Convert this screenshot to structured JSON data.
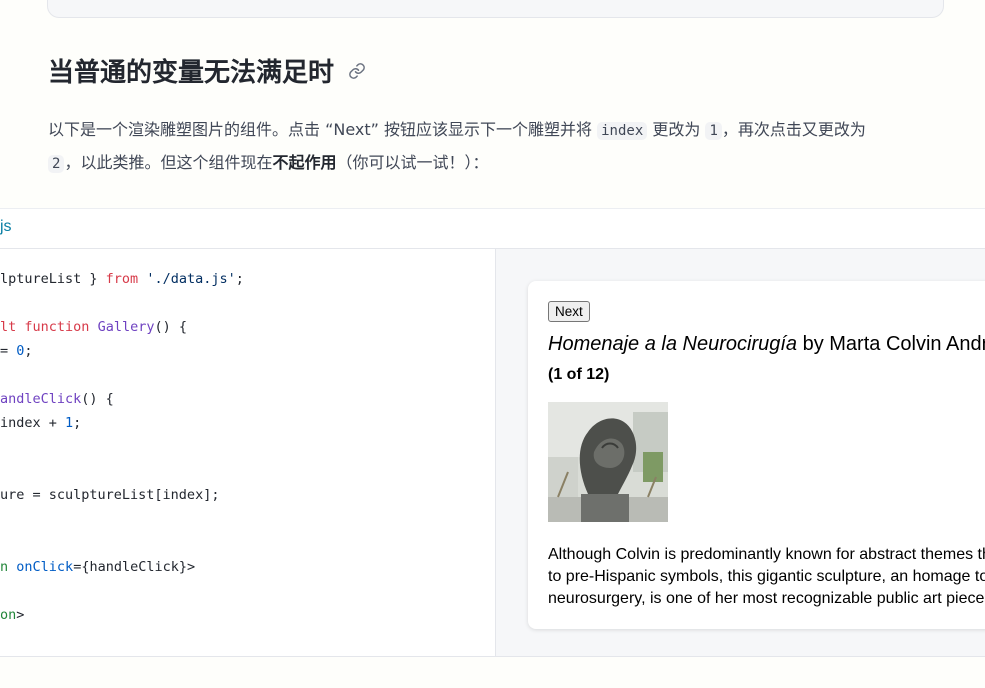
{
  "heading": "当普通的变量无法满足时",
  "intro": {
    "part1": "以下是一个渲染雕塑图片的组件。点击 “Next” 按钮应该显示下一个雕塑并将 ",
    "code1": "index",
    "part2": " 更改为 ",
    "code2": "1",
    "part3": "，再次点击又更改为 ",
    "code3": "2",
    "part4": "，以此类推。但这个组件现在",
    "strong": "不起作用",
    "part5": "（你可以试一试！）："
  },
  "sandbox": {
    "tab_label": "js",
    "code": {
      "l1": {
        "a": "lptureList } ",
        "kw": "from",
        "b": " ",
        "str": "'./data.js'",
        "c": ";"
      },
      "l2": {
        "kw": "lt",
        "b": " ",
        "kw2": "function",
        "c": " ",
        "fn": "Gallery",
        "d": "() {"
      },
      "l3": {
        "a": "= ",
        "num": "0",
        "b": ";"
      },
      "l4": {
        "fn": "andleClick",
        "a": "() {"
      },
      "l5": {
        "a": "index + ",
        "num": "1",
        "b": ";"
      },
      "l6": {
        "a": "ure = sculptureList[index];"
      },
      "l7": {
        "tag": "n",
        "a": " ",
        "attr": "onClick",
        "b": "={handleClick}>"
      },
      "l8": {
        "tag": "on",
        "a": ">"
      }
    },
    "preview": {
      "next_label": "Next",
      "title_italic": "Homenaje a la Neurocirugía",
      "title_rest": " by Marta Colvin Andrade",
      "counter": "(1 of 12)",
      "desc_line1": "Although Colvin is predominantly known for abstract themes that allude",
      "desc_line2": "to pre-Hispanic symbols, this gigantic sculpture, an homage to",
      "desc_line3": "neurosurgery, is one of her most recognizable public art pieces."
    }
  }
}
